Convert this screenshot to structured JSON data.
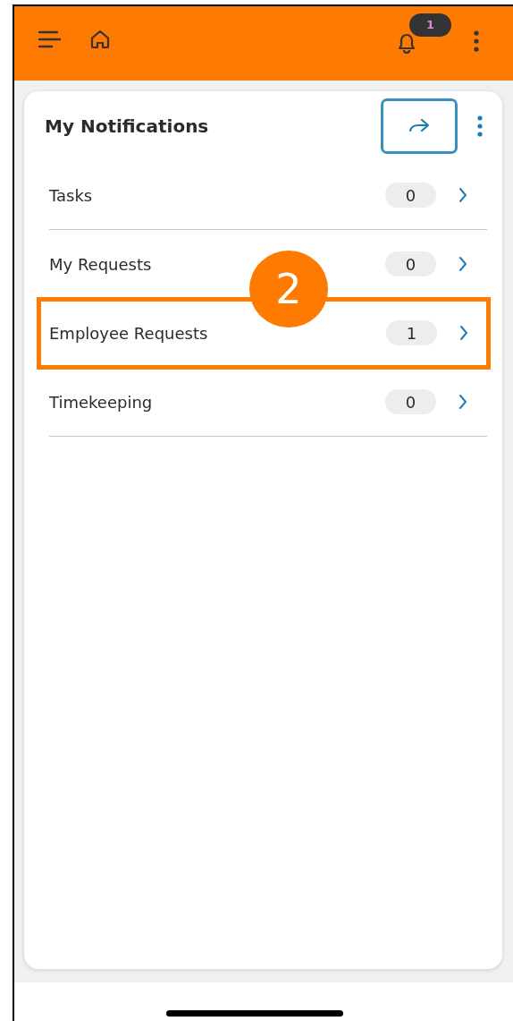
{
  "header": {
    "notification_badge": "1"
  },
  "card": {
    "title": "My Notifications",
    "items": [
      {
        "label": "Tasks",
        "count": "0",
        "highlighted": false
      },
      {
        "label": "My Requests",
        "count": "0",
        "highlighted": false
      },
      {
        "label": "Employee Requests",
        "count": "1",
        "highlighted": true
      },
      {
        "label": "Timekeeping",
        "count": "0",
        "highlighted": false
      }
    ]
  },
  "callout": {
    "number": "2"
  }
}
